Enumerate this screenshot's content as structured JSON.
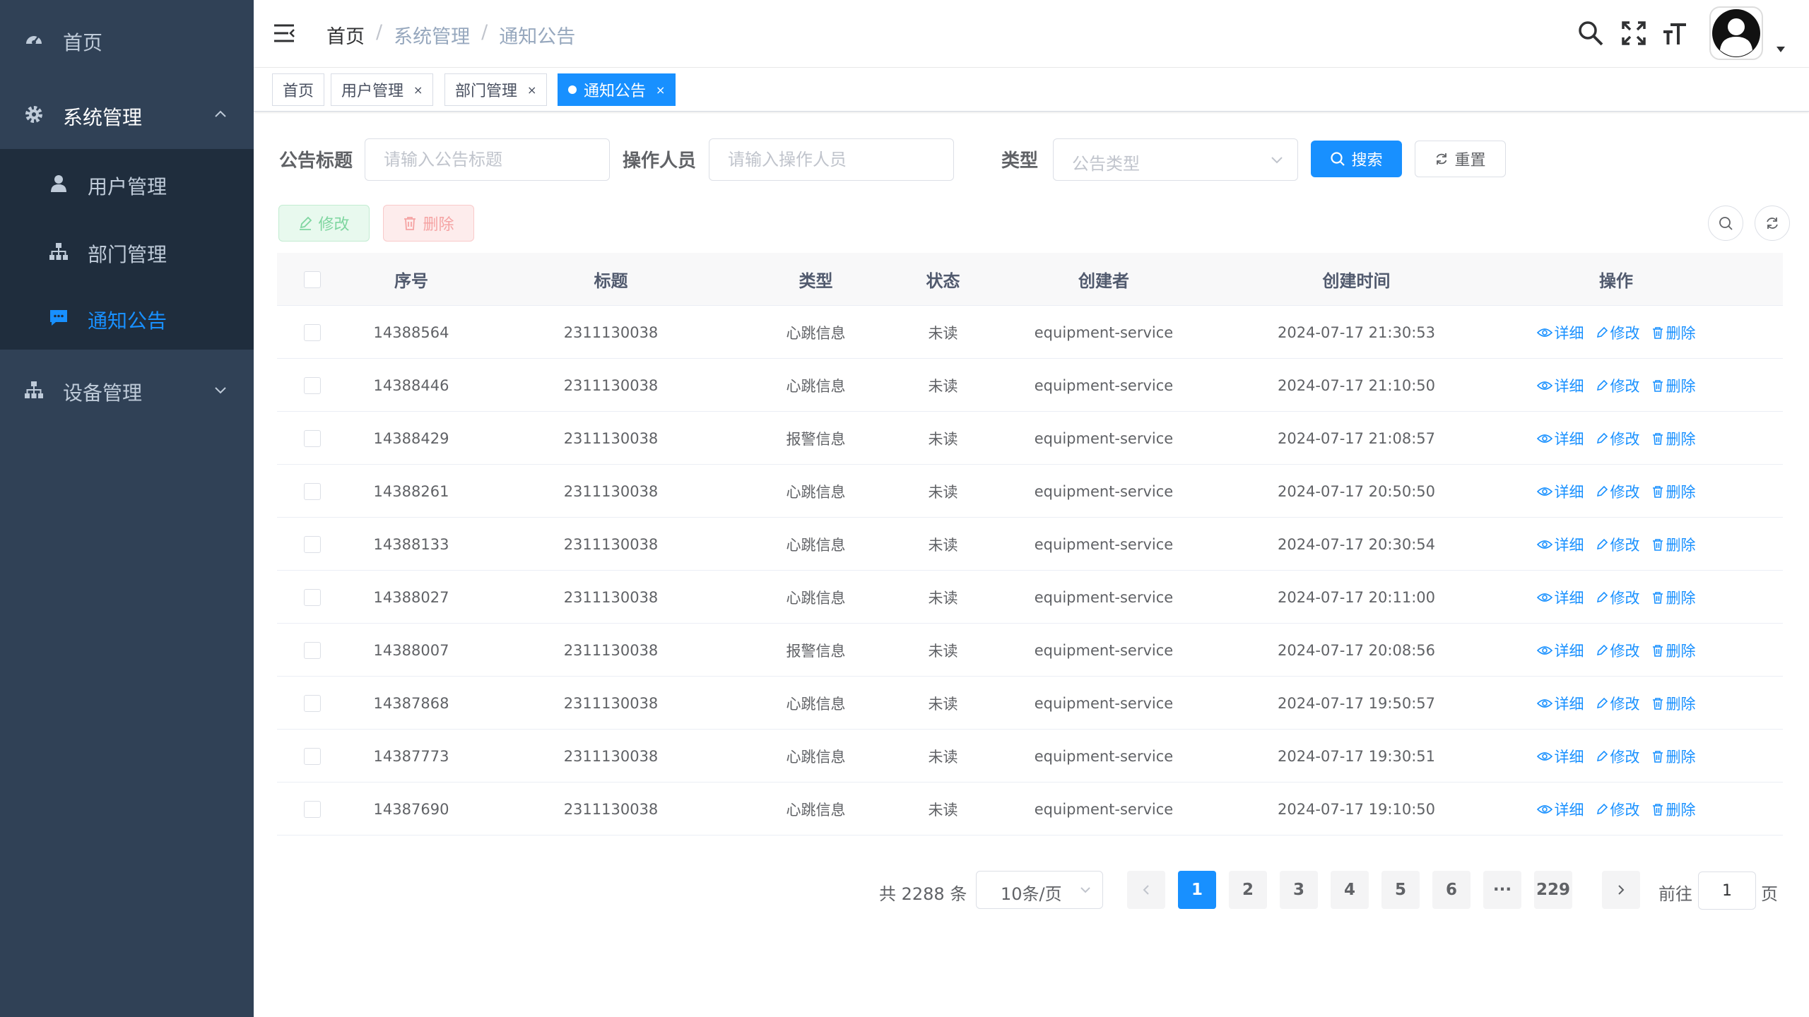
{
  "sidebar": {
    "items": [
      {
        "label": "首页",
        "icon": "dashboard-icon"
      },
      {
        "label": "系统管理",
        "icon": "gear-icon"
      },
      {
        "label": "用户管理",
        "icon": "user-icon"
      },
      {
        "label": "部门管理",
        "icon": "tree-icon"
      },
      {
        "label": "通知公告",
        "icon": "message-icon"
      },
      {
        "label": "设备管理",
        "icon": "tree-icon"
      }
    ],
    "active_color": "#1890ff"
  },
  "navbar": {
    "breadcrumb": [
      "首页",
      "系统管理",
      "通知公告"
    ],
    "separator": "/"
  },
  "tags": [
    {
      "label": "首页"
    },
    {
      "label": "用户管理",
      "close": "×"
    },
    {
      "label": "部门管理",
      "close": "×"
    },
    {
      "label": "通知公告",
      "close": "×"
    }
  ],
  "search": {
    "title_label": "公告标题",
    "title_placeholder": "请输入公告标题",
    "operator_label": "操作人员",
    "operator_placeholder": "请输入操作人员",
    "type_label": "类型",
    "type_placeholder": "公告类型",
    "search_button": "搜索",
    "reset_button": "重置"
  },
  "toolbar": {
    "edit_label": "修改",
    "delete_label": "删除"
  },
  "table": {
    "columns": [
      "序号",
      "标题",
      "类型",
      "状态",
      "创建者",
      "创建时间",
      "操作"
    ],
    "actions": [
      "详细",
      "修改",
      "删除"
    ],
    "rows": [
      [
        "14388564",
        "2311130038",
        "心跳信息",
        "未读",
        "equipment-service",
        "2024-07-17 21:30:53"
      ],
      [
        "14388446",
        "2311130038",
        "心跳信息",
        "未读",
        "equipment-service",
        "2024-07-17 21:10:50"
      ],
      [
        "14388429",
        "2311130038",
        "报警信息",
        "未读",
        "equipment-service",
        "2024-07-17 21:08:57"
      ],
      [
        "14388261",
        "2311130038",
        "心跳信息",
        "未读",
        "equipment-service",
        "2024-07-17 20:50:50"
      ],
      [
        "14388133",
        "2311130038",
        "心跳信息",
        "未读",
        "equipment-service",
        "2024-07-17 20:30:54"
      ],
      [
        "14388027",
        "2311130038",
        "心跳信息",
        "未读",
        "equipment-service",
        "2024-07-17 20:11:00"
      ],
      [
        "14388007",
        "2311130038",
        "报警信息",
        "未读",
        "equipment-service",
        "2024-07-17 20:08:56"
      ],
      [
        "14387868",
        "2311130038",
        "心跳信息",
        "未读",
        "equipment-service",
        "2024-07-17 19:50:57"
      ],
      [
        "14387773",
        "2311130038",
        "心跳信息",
        "未读",
        "equipment-service",
        "2024-07-17 19:30:51"
      ],
      [
        "14387690",
        "2311130038",
        "心跳信息",
        "未读",
        "equipment-service",
        "2024-07-17 19:10:50"
      ]
    ]
  },
  "pagination": {
    "total_text": "共 2288 条",
    "page_size": "10条/页",
    "pages": [
      "1",
      "2",
      "3",
      "4",
      "5",
      "6",
      "···",
      "229"
    ],
    "current_page": "1",
    "goto_label": "前往",
    "goto_value": "1",
    "goto_suffix": "页"
  }
}
